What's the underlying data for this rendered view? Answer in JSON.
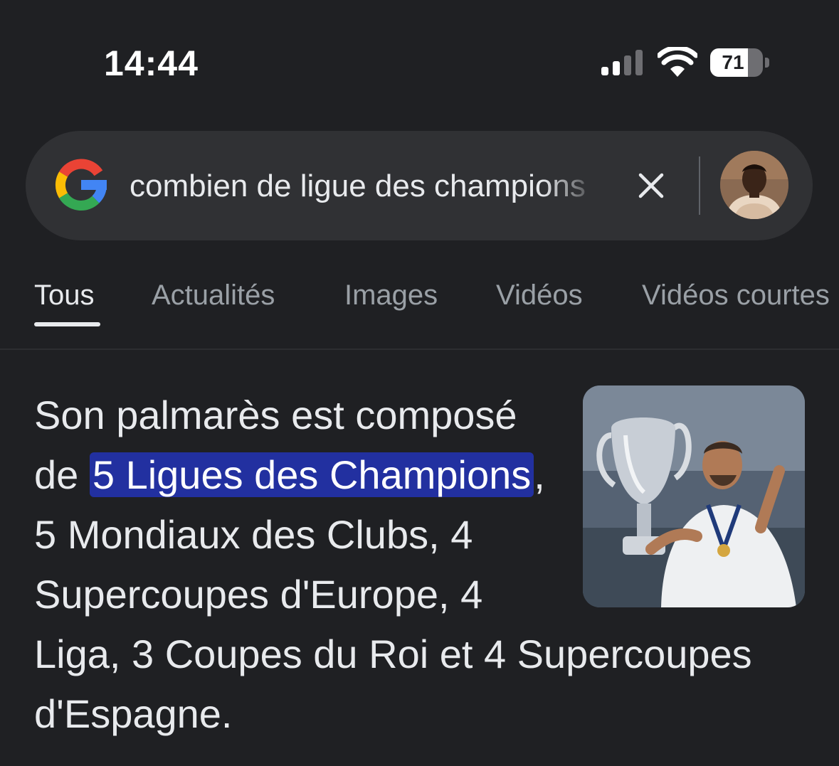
{
  "status_bar": {
    "time": "14:44",
    "signal_icon": "cellular-signal-icon",
    "wifi_icon": "wifi-icon",
    "battery_level": 71,
    "battery_label": "71"
  },
  "search": {
    "query": "combien de ligue des champions",
    "logo_icon": "google-g-logo",
    "clear_icon": "close-icon",
    "avatar": "user-avatar"
  },
  "tabs": [
    {
      "label": "Tous",
      "active": true
    },
    {
      "label": "Actualités",
      "active": false
    },
    {
      "label": "Images",
      "active": false
    },
    {
      "label": "Vidéos",
      "active": false
    },
    {
      "label": "Vidéos courtes",
      "active": false
    }
  ],
  "answer": {
    "text_before": "Son palmarès est composé de ",
    "highlight": "5 Ligues des Champions",
    "text_after": ", 5 Mondiaux des Clubs, 4 Supercoupes d'Europe, 4 Liga, 3 Coupes du Roi et 4 Supercoupes d'Espagne.",
    "image_icon": "trophy-player-photo"
  },
  "colors": {
    "background": "#1f2023",
    "search_bar": "#303134",
    "highlight": "#2230a0",
    "tab_inactive": "#9aa0a6",
    "text": "#e8eaed"
  }
}
